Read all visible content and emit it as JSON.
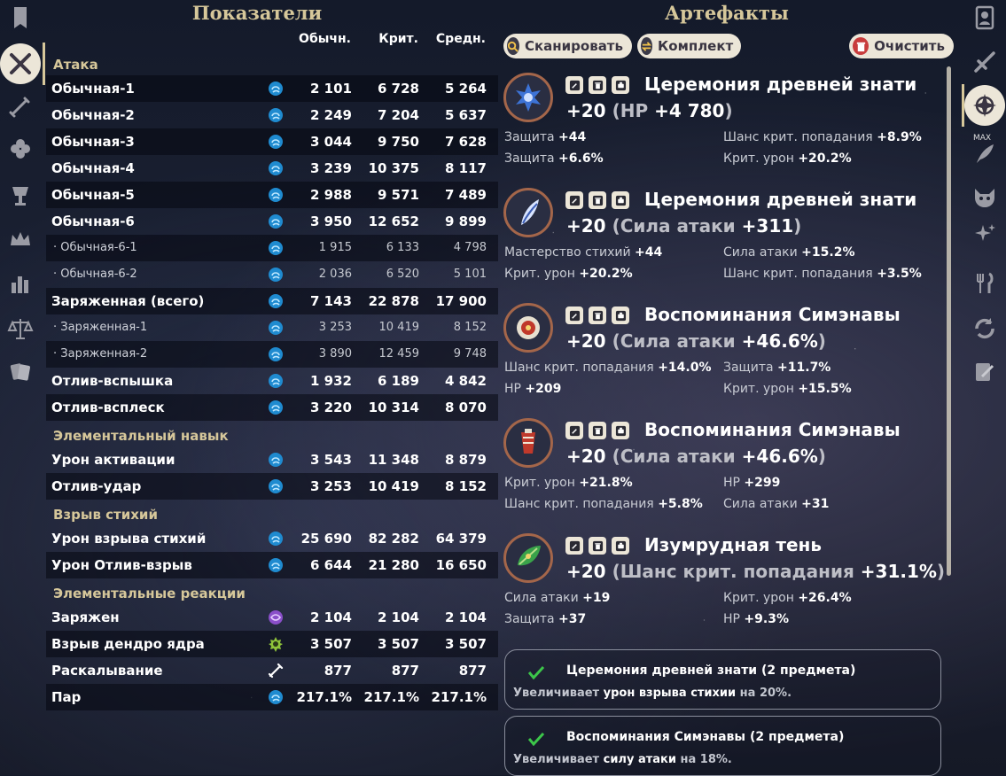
{
  "stats": {
    "title": "Показатели",
    "columns": [
      "Обычн.",
      "Крит.",
      "Средн."
    ],
    "sections": [
      {
        "title": "Атака",
        "rows": [
          {
            "label": "Обычная-1",
            "icon": "hydro-icon",
            "values": [
              "2 101",
              "6 728",
              "5 264"
            ]
          },
          {
            "label": "Обычная-2",
            "icon": "hydro-icon",
            "values": [
              "2 249",
              "7 204",
              "5 637"
            ]
          },
          {
            "label": "Обычная-3",
            "icon": "hydro-icon",
            "values": [
              "3 044",
              "9 750",
              "7 628"
            ]
          },
          {
            "label": "Обычная-4",
            "icon": "hydro-icon",
            "values": [
              "3 239",
              "10 375",
              "8 117"
            ]
          },
          {
            "label": "Обычная-5",
            "icon": "hydro-icon",
            "values": [
              "2 988",
              "9 571",
              "7 489"
            ]
          },
          {
            "label": "Обычная-6",
            "icon": "hydro-icon",
            "values": [
              "3 950",
              "12 652",
              "9 899"
            ]
          },
          {
            "label": "· Обычная-6-1",
            "icon": "hydro-icon",
            "values": [
              "1 915",
              "6 133",
              "4 798"
            ],
            "sub": true
          },
          {
            "label": "· Обычная-6-2",
            "icon": "hydro-icon",
            "values": [
              "2 036",
              "6 520",
              "5 101"
            ],
            "sub": true
          },
          {
            "label": "Заряженная (всего)",
            "icon": "hydro-icon",
            "values": [
              "7 143",
              "22 878",
              "17 900"
            ]
          },
          {
            "label": "· Заряженная-1",
            "icon": "hydro-icon",
            "values": [
              "3 253",
              "10 419",
              "8 152"
            ],
            "sub": true
          },
          {
            "label": "· Заряженная-2",
            "icon": "hydro-icon",
            "values": [
              "3 890",
              "12 459",
              "9 748"
            ],
            "sub": true
          },
          {
            "label": "Отлив-вспышка",
            "icon": "hydro-icon",
            "values": [
              "1 932",
              "6 189",
              "4 842"
            ]
          },
          {
            "label": "Отлив-всплеск",
            "icon": "hydro-icon",
            "values": [
              "3 220",
              "10 314",
              "8 070"
            ]
          }
        ]
      },
      {
        "title": "Элементальный навык",
        "rows": [
          {
            "label": "Урон активации",
            "icon": "hydro-icon",
            "values": [
              "3 543",
              "11 348",
              "8 879"
            ]
          },
          {
            "label": "Отлив-удар",
            "icon": "hydro-icon",
            "values": [
              "3 253",
              "10 419",
              "8 152"
            ]
          }
        ]
      },
      {
        "title": "Взрыв стихий",
        "rows": [
          {
            "label": "Урон взрыва стихий",
            "icon": "hydro-icon",
            "values": [
              "25 690",
              "82 282",
              "64 379"
            ]
          },
          {
            "label": "Урон Отлив-взрыв",
            "icon": "hydro-icon",
            "values": [
              "6 644",
              "21 280",
              "16 650"
            ]
          }
        ]
      },
      {
        "title": "Элементальные реакции",
        "rows": [
          {
            "label": "Заряжен",
            "icon": "electro-icon",
            "values": [
              "2 104",
              "2 104",
              "2 104"
            ]
          },
          {
            "label": "Взрыв дендро ядра",
            "icon": "dendro-icon",
            "values": [
              "3 507",
              "3 507",
              "3 507"
            ]
          },
          {
            "label": "Раскалывание",
            "icon": "sword-icon",
            "values": [
              "877",
              "877",
              "877"
            ]
          },
          {
            "label": "Пар",
            "icon": "hydro-icon",
            "values": [
              "217.1%",
              "217.1%",
              "217.1%"
            ]
          }
        ]
      }
    ]
  },
  "artifacts": {
    "title": "Артефакты",
    "scan_label": "Сканировать",
    "set_label": "Комплект",
    "clear_label": "Очистить",
    "items": [
      {
        "name": "Церемония древней знати",
        "level": "+20",
        "main_stat": "HP",
        "main_value": "+4 780",
        "icon": "flower-artifact-icon",
        "subs": [
          [
            "Защита",
            "+44"
          ],
          [
            "Шанс крит. попадания",
            "+8.9%"
          ],
          [
            "Защита",
            "+6.6%"
          ],
          [
            "Крит. урон",
            "+20.2%"
          ]
        ]
      },
      {
        "name": "Церемония древней знати",
        "level": "+20",
        "main_stat": "Сила атаки",
        "main_value": "+311",
        "icon": "plume-artifact-icon",
        "subs": [
          [
            "Мастерство стихий",
            "+44"
          ],
          [
            "Сила атаки",
            "+15.2%"
          ],
          [
            "Крит. урон",
            "+20.2%"
          ],
          [
            "Шанс крит. попадания",
            "+3.5%"
          ]
        ]
      },
      {
        "name": "Воспоминания Симэнавы",
        "level": "+20",
        "main_stat": "Сила атаки",
        "main_value": "+46.6%",
        "icon": "sands-artifact-icon",
        "subs": [
          [
            "Шанс крит. попадания",
            "+14.0%"
          ],
          [
            "Защита",
            "+11.7%"
          ],
          [
            "HP",
            "+209"
          ],
          [
            "Крит. урон",
            "+15.5%"
          ]
        ]
      },
      {
        "name": "Воспоминания Симэнавы",
        "level": "+20",
        "main_stat": "Сила атаки",
        "main_value": "+46.6%",
        "icon": "goblet-artifact-icon",
        "subs": [
          [
            "Крит. урон",
            "+21.8%"
          ],
          [
            "HP",
            "+299"
          ],
          [
            "Шанс крит. попадания",
            "+5.8%"
          ],
          [
            "Сила атаки",
            "+31"
          ]
        ]
      },
      {
        "name": "Изумрудная тень",
        "level": "+20",
        "main_stat": "Шанс крит. попадания",
        "main_value": "+31.1%",
        "icon": "circlet-artifact-icon",
        "subs": [
          [
            "Сила атаки",
            "+19"
          ],
          [
            "Крит. урон",
            "+26.4%"
          ],
          [
            "Защита",
            "+37"
          ],
          [
            "HP",
            "+9.3%"
          ]
        ]
      }
    ],
    "sets": [
      {
        "title": "Церемония древней знати (2 предмета)",
        "desc_before": "Увеличивает",
        "desc_hl": "урон взрыва стихии",
        "desc_after": "на 20%."
      },
      {
        "title": "Воспоминания Симэнавы (2 предмета)",
        "desc_before": "Увеличивает",
        "desc_hl": "силу атаки",
        "desc_after": "на 18%."
      }
    ]
  },
  "right_sidebar": {
    "max_label": "MAX"
  },
  "colors": {
    "gold": "#d6c79a",
    "hydro": "#29a9e0",
    "electro": "#b27ae0",
    "dendro": "#8fc43a",
    "accent_ring": "#a4664a"
  }
}
